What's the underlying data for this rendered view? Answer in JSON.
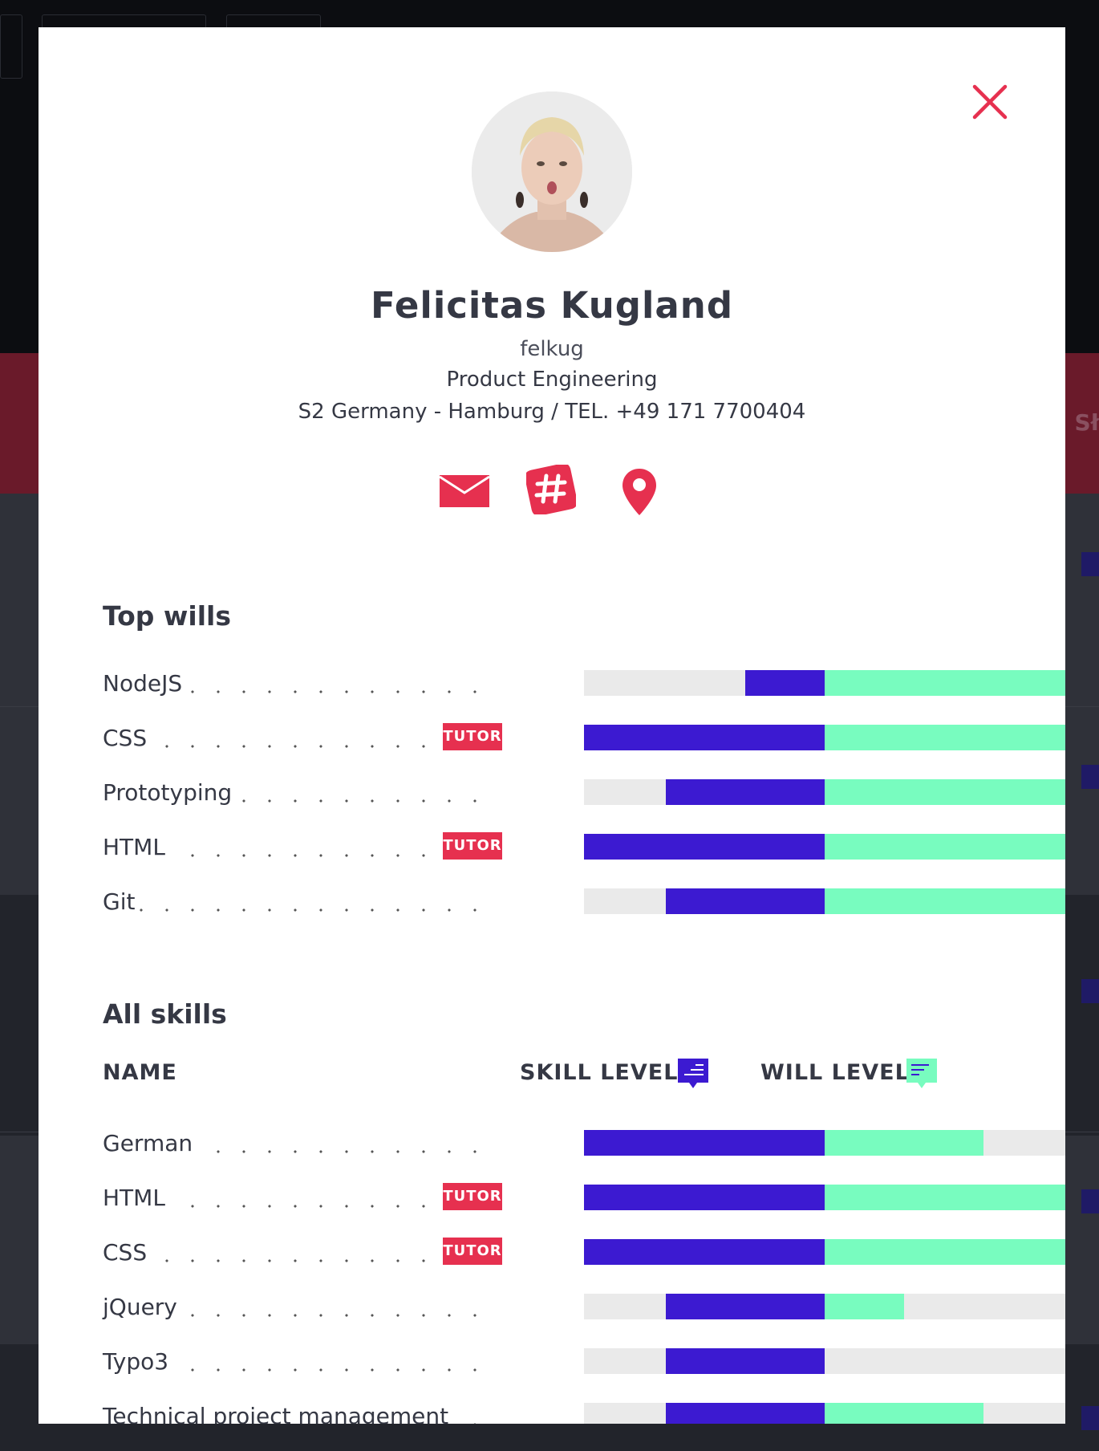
{
  "profile": {
    "name": "Felicitas Kugland",
    "handle": "felkug",
    "department": "Product Engineering",
    "location": "S2 Germany - Hamburg / TEL. +49 171 7700404"
  },
  "background": {
    "band_text": "Sł"
  },
  "sections": {
    "top_wills_title": "Top wills",
    "all_skills_title": "All skills"
  },
  "table_header": {
    "name": "NAME",
    "skill_level": "SKILL LEVEL",
    "will_level": "WILL LEVEL"
  },
  "top_wills": [
    {
      "name": "NodeJS",
      "tutor": false,
      "skill": 0.33,
      "will": 1.0
    },
    {
      "name": "CSS",
      "tutor": true,
      "skill": 1.0,
      "will": 1.0
    },
    {
      "name": "Prototyping",
      "tutor": false,
      "skill": 0.66,
      "will": 1.0
    },
    {
      "name": "HTML",
      "tutor": true,
      "skill": 1.0,
      "will": 1.0
    },
    {
      "name": "Git",
      "tutor": false,
      "skill": 0.66,
      "will": 1.0
    }
  ],
  "all_skills": [
    {
      "name": "German",
      "tutor": false,
      "skill": 1.0,
      "will": 0.66
    },
    {
      "name": "HTML",
      "tutor": true,
      "skill": 1.0,
      "will": 1.0
    },
    {
      "name": "CSS",
      "tutor": true,
      "skill": 1.0,
      "will": 1.0
    },
    {
      "name": "jQuery",
      "tutor": false,
      "skill": 0.66,
      "will": 0.33
    },
    {
      "name": "Typo3",
      "tutor": false,
      "skill": 0.66,
      "will": 0.0
    },
    {
      "name": "Technical project management",
      "tutor": false,
      "skill": 0.66,
      "will": 0.66
    }
  ],
  "tutor_label": "TUTOR",
  "colors": {
    "accent": "#e6304f",
    "skill": "#3c1ad1",
    "will": "#78fcbf",
    "empty": "#eaeaea"
  }
}
